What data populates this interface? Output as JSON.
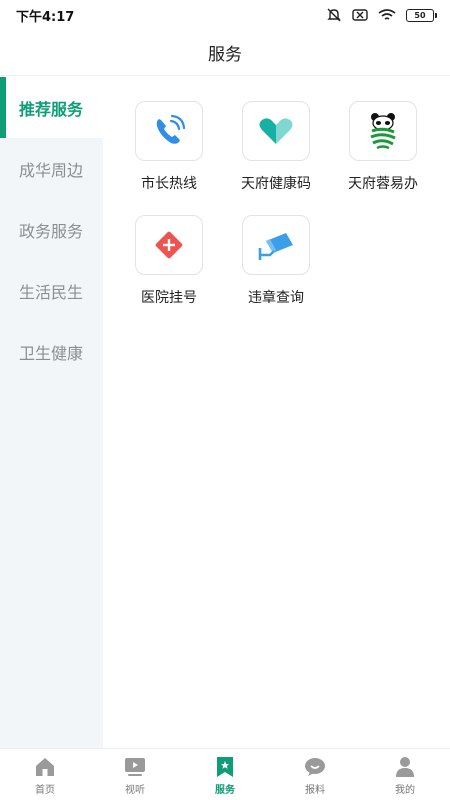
{
  "status_bar": {
    "time": "下午4:17",
    "battery": "50"
  },
  "header": {
    "title": "服务"
  },
  "sidebar": {
    "items": [
      {
        "label": "推荐服务",
        "active": true
      },
      {
        "label": "成华周边",
        "active": false
      },
      {
        "label": "政务服务",
        "active": false
      },
      {
        "label": "生活民生",
        "active": false
      },
      {
        "label": "卫生健康",
        "active": false
      }
    ]
  },
  "services": [
    {
      "label": "市长热线",
      "icon": "phone-icon"
    },
    {
      "label": "天府健康码",
      "icon": "health-code-icon"
    },
    {
      "label": "天府蓉易办",
      "icon": "panda-icon"
    },
    {
      "label": "医院挂号",
      "icon": "medical-cross-icon"
    },
    {
      "label": "违章查询",
      "icon": "traffic-camera-icon"
    }
  ],
  "tabbar": {
    "tabs": [
      {
        "label": "首页",
        "icon": "home-icon"
      },
      {
        "label": "视听",
        "icon": "video-icon"
      },
      {
        "label": "服务",
        "icon": "service-bookmark-icon",
        "active": true
      },
      {
        "label": "报料",
        "icon": "chat-bubble-icon"
      },
      {
        "label": "我的",
        "icon": "user-icon"
      }
    ]
  },
  "colors": {
    "accent": "#0f9d78",
    "sidebar_bg": "#f2f6f9",
    "inactive_text": "#8c8f92"
  }
}
